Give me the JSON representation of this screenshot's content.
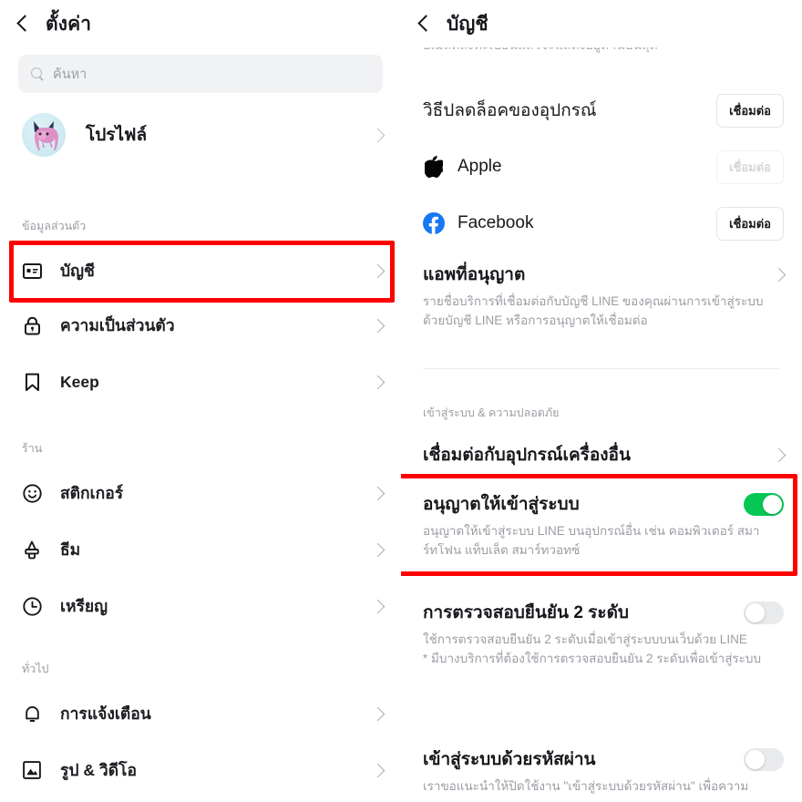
{
  "left_panel": {
    "header": {
      "title": "ตั้งค่า",
      "back_icon": "chevron-left-icon"
    },
    "search": {
      "placeholder": "ค้นหา",
      "icon": "search-icon"
    },
    "profile": {
      "label": "โปรไฟล์",
      "avatar_icon": "profile-avatar"
    },
    "sections": [
      {
        "label": "ข้อมูลส่วนตัว",
        "items": [
          {
            "label": "บัญชี",
            "icon": "id-card-icon",
            "highlighted": true
          },
          {
            "label": "ความเป็นส่วนตัว",
            "icon": "lock-icon",
            "highlighted": false
          },
          {
            "label": "Keep",
            "icon": "bookmark-icon",
            "highlighted": false
          }
        ]
      },
      {
        "label": "ร้าน",
        "items": [
          {
            "label": "สติกเกอร์",
            "icon": "smiley-icon",
            "highlighted": false
          },
          {
            "label": "ธีม",
            "icon": "brush-icon",
            "highlighted": false
          },
          {
            "label": "เหรียญ",
            "icon": "coin-clock-icon",
            "highlighted": false
          }
        ]
      },
      {
        "label": "ทั่วไป",
        "items": [
          {
            "label": "การแจ้งเตือน",
            "icon": "bell-icon",
            "highlighted": false
          },
          {
            "label": "รูป & วิดีโอ",
            "icon": "photo-icon",
            "highlighted": false
          }
        ]
      }
    ]
  },
  "right_panel": {
    "header": {
      "title": "บัญชี",
      "back_icon": "chevron-left-icon"
    },
    "clipped_top_text": "อีเมลที่ลงทะเบียนแล้วจะแสดงอยู่ด้านบนสุด",
    "rows": [
      {
        "type": "action",
        "title": "วิธีปลดล็อคของอุปกรณ์",
        "button_label": "เชื่อมต่อ",
        "button_disabled": false
      },
      {
        "type": "brand",
        "icon": "apple-icon",
        "name": "Apple",
        "button_label": "เชื่อมต่อ",
        "button_disabled": true
      },
      {
        "type": "brand",
        "icon": "facebook-icon",
        "name": "Facebook",
        "button_label": "เชื่อมต่อ",
        "button_disabled": false
      },
      {
        "type": "nav",
        "title": "แอพที่อนุญาต",
        "desc": "รายชื่อบริการที่เชื่อมต่อกับบัญชี LINE ของคุณผ่านการเข้าสู่ระบบด้วยบัญชี LINE หรือการอนุญาตให้เชื่อมต่อ"
      }
    ],
    "security_section": {
      "label": "เข้าสู่ระบบ & ความปลอดภัย",
      "items": [
        {
          "type": "nav",
          "title": "เชื่อมต่อกับอุปกรณ์เครื่องอื่น"
        },
        {
          "type": "toggle",
          "title": "อนุญาตให้เข้าสู่ระบบ",
          "desc": "อนุญาตให้เข้าสู่ระบบ LINE บนอุปกรณ์อื่น เช่น คอมพิวเตอร์ สมาร์ทโฟน แท็บเล็ต สมาร์ทวอทซ์",
          "toggle_state": "on",
          "highlighted": true
        },
        {
          "type": "toggle",
          "title": "การตรวจสอบยืนยัน 2 ระดับ",
          "desc": "ใช้การตรวจสอบยืนยัน 2 ระดับเมื่อเข้าสู่ระบบบนเว็บด้วย LINE\n* มีบางบริการที่ต้องใช้การตรวจสอบยืนยัน 2 ระดับเพื่อเข้าสู่ระบบ",
          "toggle_state": "off",
          "highlighted": false
        },
        {
          "type": "toggle",
          "title": "เข้าสู่ระบบด้วยรหัสผ่าน",
          "desc": "เราขอแนะนำให้ปิดใช้งาน \"เข้าสู่ระบบด้วยรหัสผ่าน\" เพื่อความ",
          "toggle_state": "off",
          "highlighted": false
        }
      ]
    }
  },
  "colors": {
    "highlight_box": "#fe0000",
    "toggle_on": "#06c755",
    "toggle_off": "#e8eaec",
    "facebook_blue": "#1877f2",
    "text_primary": "#16181c",
    "text_muted": "#9a9da3",
    "search_bg": "#f1f2f4"
  }
}
